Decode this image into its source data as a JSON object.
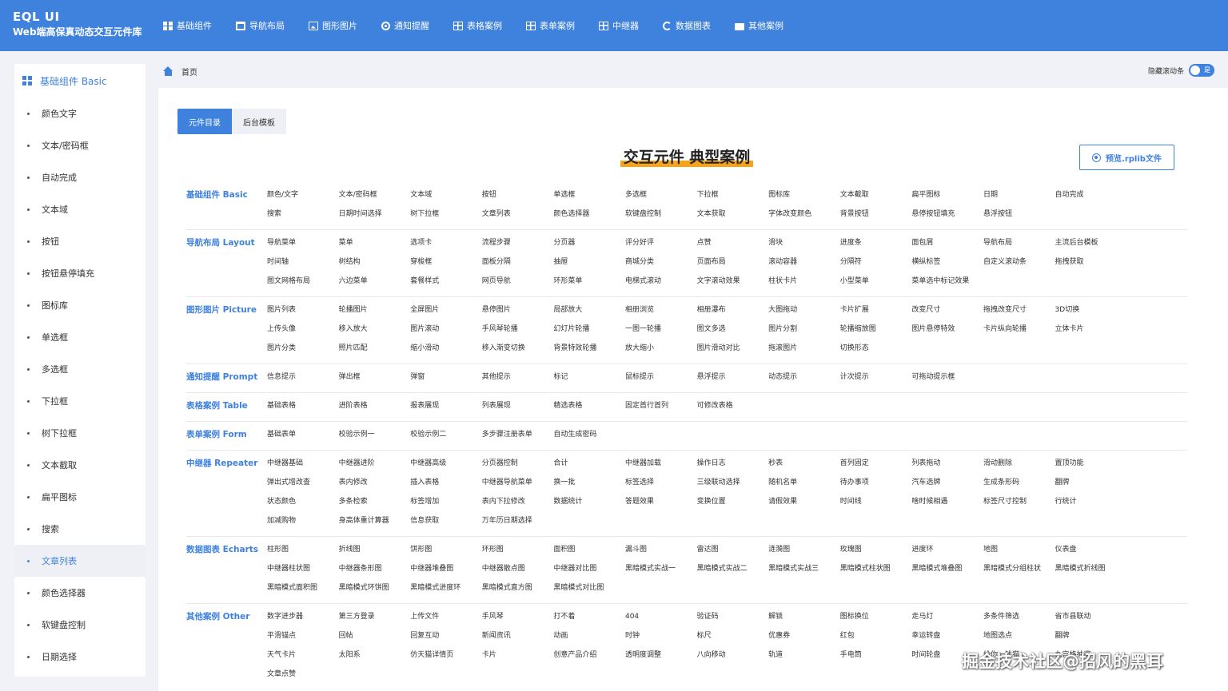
{
  "brand": {
    "title": "EQL UI",
    "subtitle": "Web端高保真动态交互元件库"
  },
  "nav": [
    {
      "label": "基础组件",
      "icon": "grid-icon"
    },
    {
      "label": "导航布局",
      "icon": "document-icon"
    },
    {
      "label": "图形图片",
      "icon": "picture-icon"
    },
    {
      "label": "通知提醒",
      "icon": "bell-circle-icon"
    },
    {
      "label": "表格案例",
      "icon": "table-icon"
    },
    {
      "label": "表单案例",
      "icon": "form-icon"
    },
    {
      "label": "中继器",
      "icon": "repeater-icon"
    },
    {
      "label": "数据图表",
      "icon": "refresh-icon"
    },
    {
      "label": "其他案例",
      "icon": "briefcase-icon"
    }
  ],
  "sidebar": {
    "header": "基础组件 Basic",
    "items": [
      {
        "label": "颜色文字",
        "active": false
      },
      {
        "label": "文本/密码框",
        "active": false
      },
      {
        "label": "自动完成",
        "active": false
      },
      {
        "label": "文本域",
        "active": false
      },
      {
        "label": "按钮",
        "active": false
      },
      {
        "label": "按钮悬停填充",
        "active": false
      },
      {
        "label": "图标库",
        "active": false
      },
      {
        "label": "单选框",
        "active": false
      },
      {
        "label": "多选框",
        "active": false
      },
      {
        "label": "下拉框",
        "active": false
      },
      {
        "label": "树下拉框",
        "active": false
      },
      {
        "label": "文本截取",
        "active": false
      },
      {
        "label": "扁平图标",
        "active": false
      },
      {
        "label": "搜索",
        "active": false
      },
      {
        "label": "文章列表",
        "active": true
      },
      {
        "label": "颜色选择器",
        "active": false
      },
      {
        "label": "软键盘控制",
        "active": false
      },
      {
        "label": "日期选择",
        "active": false
      }
    ]
  },
  "breadcrumb": {
    "home": "首页"
  },
  "toggle": {
    "label": "隐藏滚动条",
    "state": "是"
  },
  "tabs": [
    {
      "label": "元件目录",
      "active": true
    },
    {
      "label": "后台模板",
      "active": false
    }
  ],
  "page_title": "交互元件 典型案例",
  "preview_button": "预览.rplib文件",
  "sections": [
    {
      "title": "基础组件 Basic",
      "items": [
        "颜色/文字",
        "文本/密码框",
        "文本域",
        "按钮",
        "单选框",
        "多选框",
        "下拉框",
        "图标库",
        "文本截取",
        "扁平图标",
        "日期",
        "自动完成",
        "搜索",
        "日期时间选择",
        "树下拉框",
        "文章列表",
        "颜色选择器",
        "软键盘控制",
        "文本获取",
        "字体改变颜色",
        "背景按钮",
        "悬停按钮填充",
        "悬浮按钮"
      ]
    },
    {
      "title": "导航布局 Layout",
      "items": [
        "导航菜单",
        "菜单",
        "选项卡",
        "流程步骤",
        "分页器",
        "评分好评",
        "点赞",
        "滑块",
        "进度条",
        "面包屑",
        "导航布局",
        "主流后台模板",
        "时间轴",
        "树结构",
        "穿梭框",
        "面板分隔",
        "抽屉",
        "商城分类",
        "页面布局",
        "滚动容器",
        "分隔符",
        "横纵标签",
        "自定义滚动条",
        "拖拽获取",
        "图文网格布局",
        "六边菜单",
        "套餐样式",
        "网页导航",
        "环形菜单",
        "电梯式滚动",
        "文字滚动效果",
        "柱状卡片",
        "小型菜单",
        "菜单选中标记效果"
      ]
    },
    {
      "title": "图形图片 Picture",
      "items": [
        "图片列表",
        "轮播图片",
        "全屏图片",
        "悬停图片",
        "局部放大",
        "相册浏览",
        "相册瀑布",
        "大图拖动",
        "卡片扩展",
        "改变尺寸",
        "拖拽改变尺寸",
        "3D切换",
        "上传头像",
        "移入放大",
        "图片滚动",
        "手风琴轮播",
        "幻灯片轮播",
        "一图一轮播",
        "图文多选",
        "图片分割",
        "轮播缩放图",
        "图片悬停特效",
        "卡片纵向轮播",
        "立体卡片",
        "图片分类",
        "照片匹配",
        "缩小滑动",
        "移入渐变切换",
        "背景特效轮播",
        "放大缩小",
        "图片滑动对比",
        "拖滚图片",
        "切换形态"
      ]
    },
    {
      "title": "通知提醒 Prompt",
      "items": [
        "信息提示",
        "弹出框",
        "弹窗",
        "其他提示",
        "标记",
        "鼠标提示",
        "悬浮提示",
        "动态提示",
        "计次提示",
        "可拖动提示框"
      ]
    },
    {
      "title": "表格案例 Table",
      "items": [
        "基础表格",
        "进阶表格",
        "报表展现",
        "列表展现",
        "精选表格",
        "固定首行首列",
        "可修改表格"
      ]
    },
    {
      "title": "表单案例 Form",
      "items": [
        "基础表单",
        "校验示例一",
        "校验示例二",
        "多步骤注册表单",
        "自动生成密码"
      ]
    },
    {
      "title": "中继器 Repeater",
      "items": [
        "中继器基础",
        "中继器进阶",
        "中继器高级",
        "分页器控制",
        "合计",
        "中继器加载",
        "操作日志",
        "秒表",
        "首列固定",
        "列表拖动",
        "滑动删除",
        "置顶功能",
        "弹出式增改查",
        "表内修改",
        "插入表格",
        "中继器导航菜单",
        "换一批",
        "标签选择",
        "三级联动选择",
        "随机名单",
        "待办事项",
        "汽车选牌",
        "生成条形码",
        "翻牌",
        "状态颜色",
        "多条检索",
        "标签增加",
        "表内下拉修改",
        "数据统计",
        "答题效果",
        "变换位置",
        "请假效果",
        "时间线",
        "啥时候相遇",
        "标签尺寸控制",
        "行统计",
        "加减购物",
        "身高体重计算器",
        "信息获取",
        "万年历日期选择"
      ]
    },
    {
      "title": "数据图表 Echarts",
      "items": [
        "柱形图",
        "折线图",
        "饼形图",
        "环形图",
        "面积图",
        "漏斗图",
        "雷达图",
        "涟漪图",
        "玫瑰图",
        "进度环",
        "地图",
        "仪表盘",
        "中继器柱状图",
        "中继器条形图",
        "中继器堆叠图",
        "中继器散点图",
        "中继器对比图",
        "黑暗模式实战一",
        "黑暗模式实战二",
        "黑暗模式实战三",
        "黑暗模式柱状图",
        "黑暗模式堆叠图",
        "黑暗模式分组柱状",
        "黑暗模式折线图",
        "黑暗模式面积图",
        "黑暗模式环饼图",
        "黑暗模式进度环",
        "黑暗模式直方图",
        "黑暗模式对比图"
      ]
    },
    {
      "title": "其他案例 Other",
      "items": [
        "数字进步器",
        "第三方登录",
        "上传文件",
        "手风琴",
        "打不着",
        "404",
        "验证码",
        "解锁",
        "图标换位",
        "走马灯",
        "多条件筛选",
        "省市县联动",
        "平滑锚点",
        "回帖",
        "回复互动",
        "新闻资讯",
        "动画",
        "时钟",
        "标尺",
        "优惠券",
        "红包",
        "幸运转盘",
        "地图选点",
        "翻牌",
        "天气卡片",
        "太阳系",
        "仿天猫详情页",
        "卡片",
        "创意产品介绍",
        "透明度调整",
        "八向移动",
        "轨道",
        "手电筒",
        "时间轮盘",
        "给你一钱猫",
        "九宫格抽奖",
        "文章点赞"
      ]
    }
  ],
  "watermark": "掘金技术社区@招风的黑耳"
}
